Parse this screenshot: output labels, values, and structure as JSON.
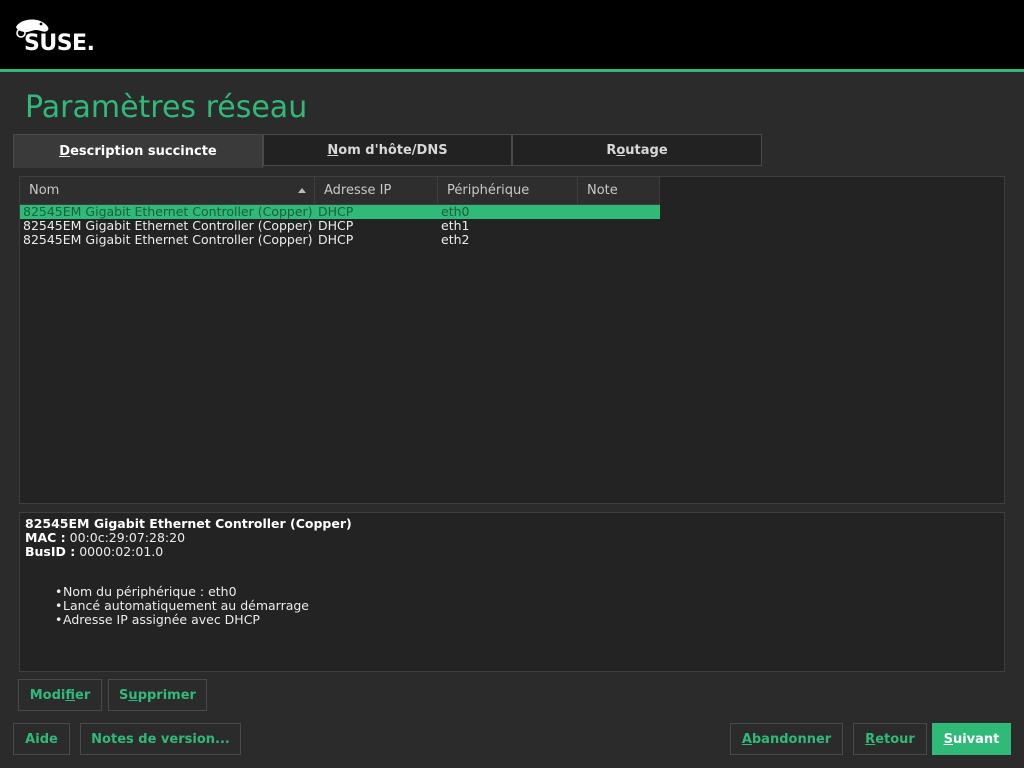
{
  "header": {
    "logo_text": "SUSE."
  },
  "page": {
    "title": "Paramètres réseau"
  },
  "tabs": [
    {
      "label_pre": "",
      "label_key": "D",
      "label_post": "escription succincte",
      "active": true
    },
    {
      "label_pre": "",
      "label_key": "N",
      "label_post": "om d'hôte/DNS",
      "active": false
    },
    {
      "label_pre": "R",
      "label_key": "o",
      "label_post": "utage",
      "active": false
    }
  ],
  "table": {
    "columns": [
      "Nom",
      "Adresse IP",
      "Périphérique",
      "Note"
    ],
    "rows": [
      {
        "name": "82545EM Gigabit Ethernet Controller (Copper)",
        "ip": "DHCP",
        "device": "eth0",
        "note": "",
        "selected": true
      },
      {
        "name": "82545EM Gigabit Ethernet Controller (Copper)",
        "ip": "DHCP",
        "device": "eth1",
        "note": "",
        "selected": false
      },
      {
        "name": "82545EM Gigabit Ethernet Controller (Copper)",
        "ip": "DHCP",
        "device": "eth2",
        "note": "",
        "selected": false
      }
    ]
  },
  "details": {
    "title": "82545EM Gigabit Ethernet Controller (Copper)",
    "mac_label": "MAC :",
    "mac_value": "00:0c:29:07:28:20",
    "busid_label": "BusID :",
    "busid_value": "0000:02:01.0",
    "bullets": [
      "Nom du périphérique : eth0",
      "Lancé automatiquement au démarrage",
      "Adresse IP assignée avec DHCP"
    ]
  },
  "actions": {
    "modify": {
      "pre": "Modi",
      "key": "f",
      "post": "ier"
    },
    "delete": {
      "pre": "S",
      "key": "u",
      "post": "pprimer"
    }
  },
  "footer": {
    "help": "Aide",
    "release_notes": "Notes de version...",
    "abort": {
      "pre": "",
      "key": "A",
      "post": "bandonner"
    },
    "back": {
      "pre": "",
      "key": "R",
      "post": "etour"
    },
    "next": {
      "pre": "",
      "key": "S",
      "post": "uivant"
    }
  },
  "colors": {
    "accent": "#30ba78",
    "background": "#2b2b2b",
    "topbar": "#000000"
  }
}
